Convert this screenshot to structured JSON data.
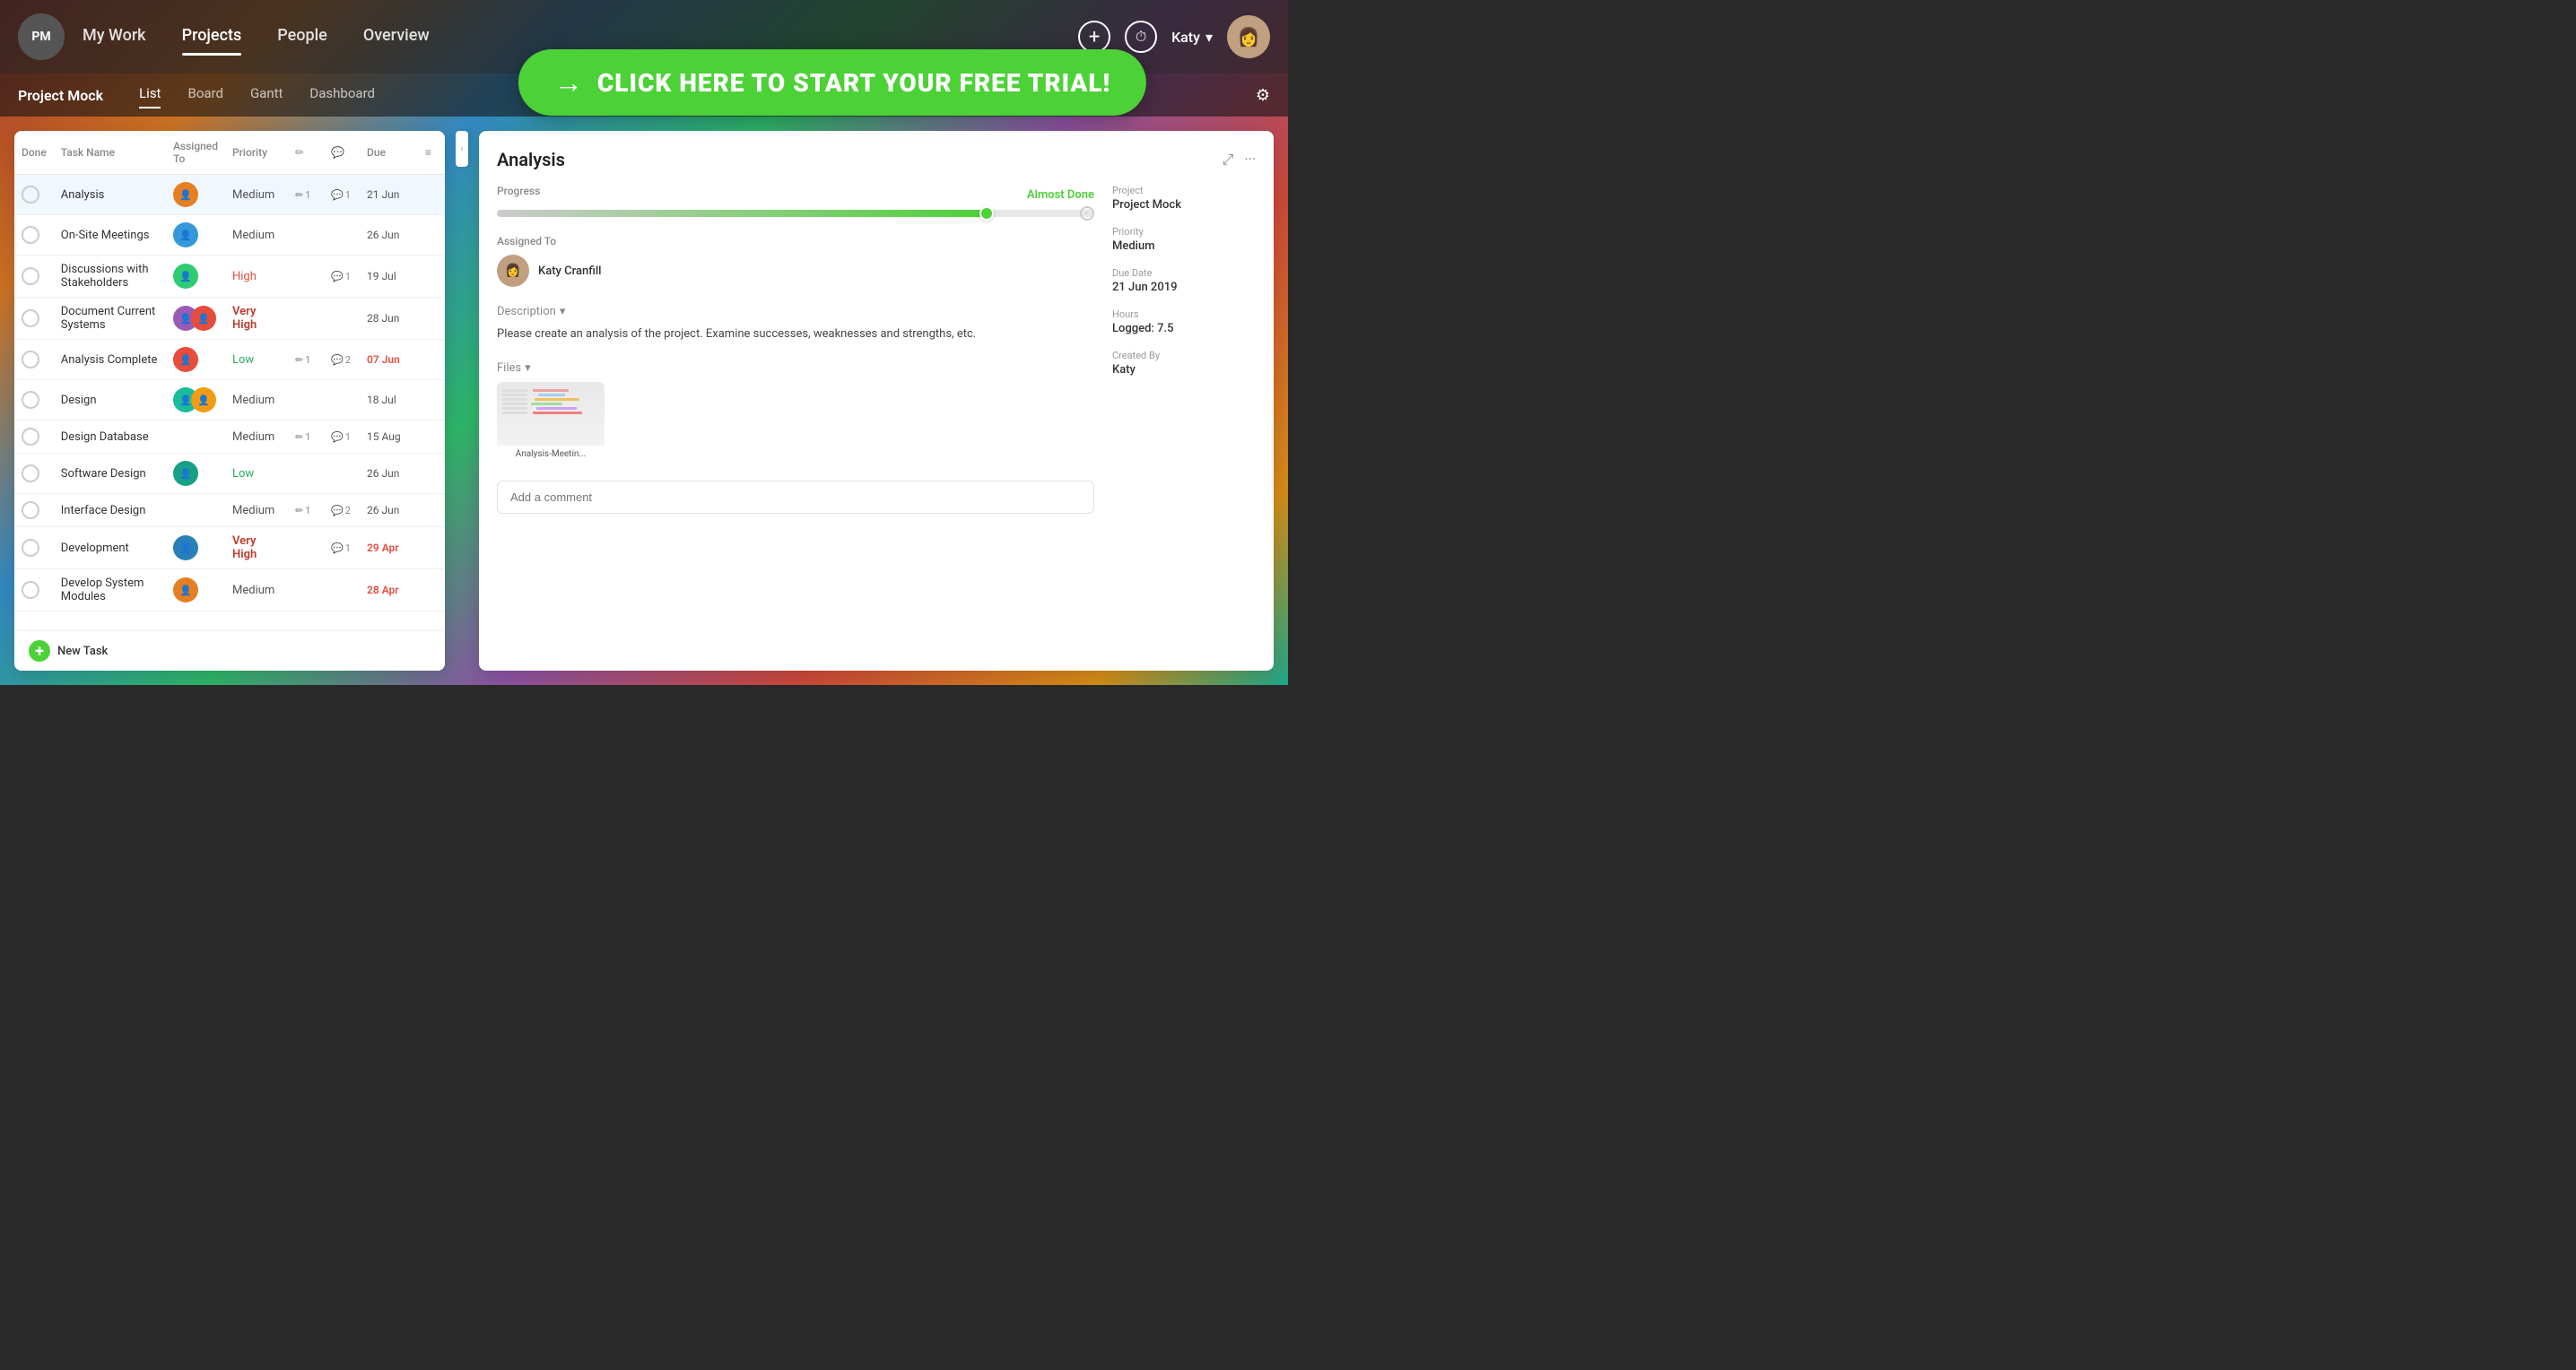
{
  "app": {
    "logo": "PM",
    "nav": [
      {
        "label": "My Work",
        "active": false
      },
      {
        "label": "Projects",
        "active": true
      },
      {
        "label": "People",
        "active": false
      },
      {
        "label": "Overview",
        "active": false
      }
    ],
    "sub_nav": [
      {
        "label": "List",
        "active": true
      },
      {
        "label": "Board",
        "active": false
      },
      {
        "label": "Gantt",
        "active": false
      },
      {
        "label": "Dashboard",
        "active": false
      }
    ],
    "project_title": "Project Mock",
    "user_name": "Katy",
    "cta_text": "CLICK HERE TO START YOUR FREE TRIAL!"
  },
  "table": {
    "columns": {
      "done": "Done",
      "task_name": "Task Name",
      "assigned_to": "Assigned To",
      "priority": "Priority",
      "due": "Due"
    },
    "tasks": [
      {
        "id": 1,
        "name": "Analysis",
        "assigned": "single",
        "priority": "Medium",
        "attachments": 1,
        "comments": 1,
        "due": "21 Jun",
        "overdue": false,
        "selected": true
      },
      {
        "id": 2,
        "name": "On-Site Meetings",
        "assigned": "single",
        "priority": "Medium",
        "attachments": 0,
        "comments": 0,
        "due": "26 Jun",
        "overdue": false
      },
      {
        "id": 3,
        "name": "Discussions with Stakeholders",
        "assigned": "single",
        "priority": "High",
        "attachments": 0,
        "comments": 1,
        "due": "19 Jul",
        "overdue": false
      },
      {
        "id": 4,
        "name": "Document Current Systems",
        "assigned": "double",
        "priority": "Very High",
        "attachments": 0,
        "comments": 0,
        "due": "28 Jun",
        "overdue": false
      },
      {
        "id": 5,
        "name": "Analysis Complete",
        "assigned": "single",
        "priority": "Low",
        "attachments": 1,
        "comments": 2,
        "due": "07 Jun",
        "overdue": true
      },
      {
        "id": 6,
        "name": "Design",
        "assigned": "double",
        "priority": "Medium",
        "attachments": 0,
        "comments": 0,
        "due": "18 Jul",
        "overdue": false
      },
      {
        "id": 7,
        "name": "Design Database",
        "assigned": "none",
        "priority": "Medium",
        "attachments": 1,
        "comments": 1,
        "due": "15 Aug",
        "overdue": false
      },
      {
        "id": 8,
        "name": "Software Design",
        "assigned": "single",
        "priority": "Low",
        "attachments": 0,
        "comments": 0,
        "due": "26 Jun",
        "overdue": false
      },
      {
        "id": 9,
        "name": "Interface Design",
        "assigned": "none",
        "priority": "Medium",
        "attachments": 1,
        "comments": 2,
        "due": "26 Jun",
        "overdue": false
      },
      {
        "id": 10,
        "name": "Development",
        "assigned": "single",
        "priority": "Very High",
        "attachments": 0,
        "comments": 1,
        "due": "29 Apr",
        "overdue": true
      },
      {
        "id": 11,
        "name": "Develop System Modules",
        "assigned": "single",
        "priority": "Medium",
        "attachments": 0,
        "comments": 0,
        "due": "28 Apr",
        "overdue": true
      }
    ],
    "new_task_label": "New Task"
  },
  "detail": {
    "title": "Analysis",
    "progress_label": "Progress",
    "progress_status": "Almost Done",
    "progress_percent": 82,
    "assigned_label": "Assigned To",
    "assigned_name": "Katy Cranfill",
    "description_label": "Description",
    "description_text": "Please create an analysis of the project. Examine successes, weaknesses and strengths, etc.",
    "files_label": "Files",
    "file_name": "Analysis-Meetin...",
    "comment_placeholder": "Add a comment",
    "meta": {
      "project_label": "Project",
      "project_value": "Project Mock",
      "priority_label": "Priority",
      "priority_value": "Medium",
      "due_date_label": "Due Date",
      "due_date_value": "21 Jun 2019",
      "hours_label": "Hours",
      "hours_logged_label": "Logged:",
      "hours_logged_value": "7.5",
      "created_by_label": "Created By",
      "created_by_value": "Katy"
    }
  }
}
